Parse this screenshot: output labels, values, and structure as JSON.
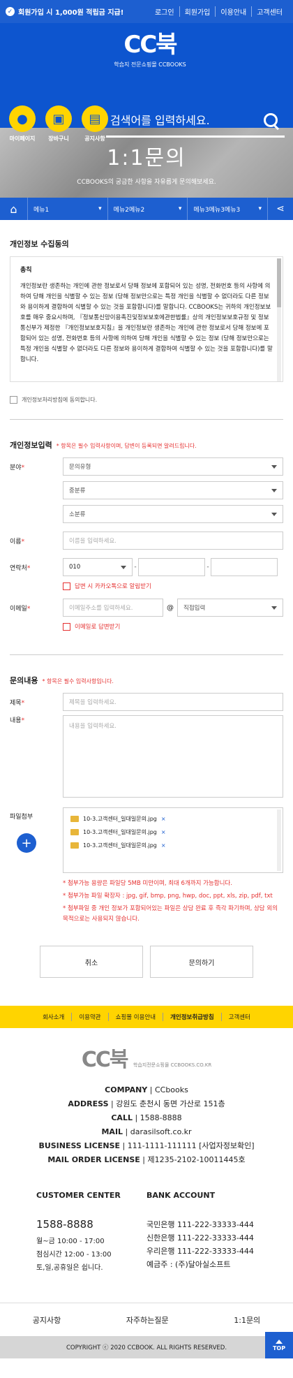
{
  "topbar": {
    "promo": "회원가입 시 1,000원 적립금 지급!",
    "links": [
      "로그인",
      "회원가입",
      "이용안내",
      "고객센터"
    ]
  },
  "header": {
    "logo_mark": "CC북",
    "logo_sub": "학습지 전문쇼핑몰 CCBOOKS",
    "icons": [
      {
        "icon": "person-icon",
        "label": "마이페이지"
      },
      {
        "icon": "basket-icon",
        "label": "장바구니"
      },
      {
        "icon": "chat-icon",
        "label": "공지사항"
      }
    ],
    "search_placeholder": "검색어를 입력하세요."
  },
  "banner": {
    "title": "1:1문의",
    "subtitle": "CCBOOKS의 궁금한 사항을 자유롭게 문의해보세요."
  },
  "navbar": {
    "menus": [
      "메뉴1",
      "메뉴2메뉴2",
      "메뉴3메뉴3메뉴3"
    ]
  },
  "privacy": {
    "title": "개인정보 수집동의",
    "terms_heading": "총칙",
    "terms_body": "개인정보란 생존하는 개인에 관한 정보로서 당해 정보에 포함되어 있는 성명, 전화번호 등의 사항에 의하여 당해 개인을 식별할 수 있는 정보 (당해 정보만으로는 특정 개인을 식별할 수 없더라도 다른 정보와 용이하게 결합하여 식별할 수 있는 것을 포함합니다)를 말합니다. CCBOOKS는 귀하의 개인정보보호를 매우 중요시하며, 『정보통신망이용촉진및정보보호에관한법률』상의 개인정보보호규정 및 정보통신부가 제정한 『개인정보보호지침』을 개인정보란 생존하는 개인에 관한 정보로서 당해 정보에 포함되어 있는 성명, 전화번호 등의 사항에 의하여 당해 개인을 식별할 수 있는 정보 (당해 정보만으로는 특정 개인을 식별할 수 없더라도 다른 정보와 용이하게 결합하여 식별할 수 있는 것을 포함합니다)를 말합니다.",
    "agree_label": "개인정보처리방침에 동의합니다."
  },
  "personal": {
    "title": "개인정보입력",
    "required_note": "* 항목은 필수 입력사항이며, 답변이 등록되면 알려드립니다.",
    "category_label": "분야",
    "category_selects": [
      "문의유형",
      "중분류",
      "소분류"
    ],
    "name_label": "이름",
    "name_placeholder": "이름을 입력하세요.",
    "phone_label": "연락처",
    "phone_prefix": "010",
    "sms_label": "답변 시 카카오톡으로 알림받기",
    "email_label": "이메일",
    "email_placeholder": "이메일주소를 입력하세요.",
    "email_at": "@",
    "email_domain": "직접입력",
    "email_reply_label": "이메일로 답변받기"
  },
  "inquiry": {
    "title": "문의내용",
    "required_note": "* 항목은 필수 입력사항입니다.",
    "subject_label": "제목",
    "subject_placeholder": "제목을 입력하세요.",
    "content_label": "내용",
    "content_placeholder": "내용을 입력하세요.",
    "attach_label": "파일첨부",
    "files": [
      "10-3.고객센터_일대일문의.jpg",
      "10-3.고객센터_일대일문의.jpg",
      "10-3.고객센터_일대일문의.jpg"
    ],
    "notes": [
      "* 첨부가능 용량은 파일당 5MB 미만이며, 최대 6개까지 가능합니다.",
      "* 첨부가능 파일 확장자 : jpg, gif, bmp, png, hwp, doc, ppt, xls, zip, pdf, txt",
      "* 첨부파일 중 개인 정보가 포함되어있는 파일은 상담 완료 후 즉각 파기하며, 상담 외의 목적으로는 사용되지 않습니다."
    ]
  },
  "buttons": {
    "cancel": "취소",
    "submit": "문의하기"
  },
  "footnav": [
    "회사소개",
    "이용약관",
    "쇼핑몰 이용안내",
    "개인정보취급방침",
    "고객센터"
  ],
  "footer": {
    "logo_mark": "CC북",
    "logo_sub": "학습지전문쇼핑몰 CCBOOKS.CO.KR",
    "lines": [
      {
        "k": "COMPANY",
        "v": "CCbooks"
      },
      {
        "k": "ADDRESS",
        "v": "강원도 춘천시 동면 가산로 151층"
      },
      {
        "k": "CALL",
        "v": "1588-8888"
      },
      {
        "k": "MAIL",
        "v": "darasilsoft.co.kr"
      },
      {
        "k": "BUSINESS LICENSE",
        "v": "111-1111-111111 [사업자정보확인]"
      },
      {
        "k": "MAIL ORDER LICENSE",
        "v": "제1235-2102-10011445호"
      }
    ],
    "cs_title": "CUSTOMER CENTER",
    "cs_phone": "1588-8888",
    "cs_hours": [
      "월~금 10:00 - 17:00",
      "점심시간 12:00 - 13:00",
      "토,일,공휴일은 쉽니다."
    ],
    "bank_title": "BANK ACCOUNT",
    "banks": [
      "국민은행 111-222-33333-444",
      "신한은행 111-222-33333-444",
      "우리은행 111-222-33333-444",
      "예금주 : (주)달아실소프트"
    ],
    "bottom_links": [
      "공지사항",
      "자주하는질문",
      "1:1문의"
    ],
    "copyright": "COPYRIGHT ⓒ 2020 CCBOOK. ALL RIGHTS RESERVED.",
    "top_label": "TOP"
  }
}
